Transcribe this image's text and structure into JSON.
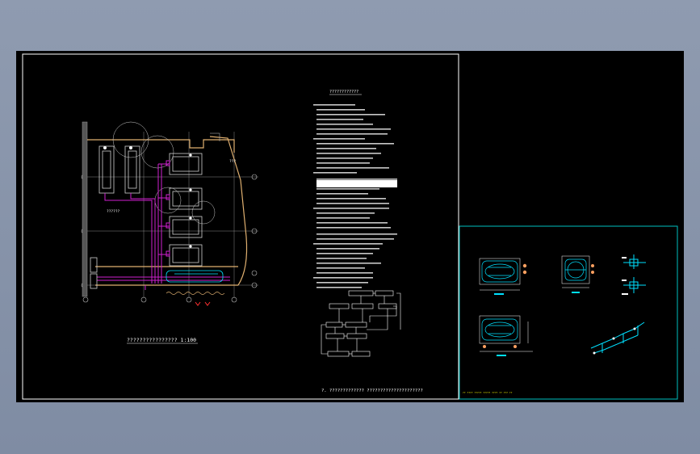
{
  "colors": {
    "background": "#8f9bb0",
    "canvas": "#000000",
    "frame": "#ffffff",
    "detail_frame": "#00c0c0",
    "pipe_magenta": "#d020d0",
    "wall_tan": "#e0b070",
    "equipment": "#d0d0d0",
    "detail_cyan": "#00e0ff",
    "note_yellow": "#ffff00"
  },
  "plan": {
    "room_label": "??????",
    "title": "???????????????? 1:100",
    "side_label": "???"
  },
  "notes": {
    "heading": "????????????"
  },
  "flow": {
    "caption": "?. ????????????? ?????????????????????"
  },
  "details": {
    "footer_note": "?? ???? ????? ????? ???? ?? ??? ??"
  }
}
